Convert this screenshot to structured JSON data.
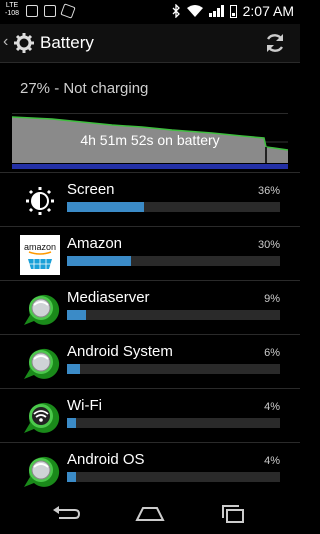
{
  "status_bar": {
    "network_label_top": "LTE",
    "network_label_bottom": "-108",
    "time": "2:07 AM"
  },
  "action_bar": {
    "title": "Battery",
    "icon": "battery-settings-icon",
    "refresh_icon": "refresh-icon"
  },
  "battery": {
    "status": "27% - Not charging",
    "graph_label": "4h 51m 52s on battery",
    "level_fraction": 0.27
  },
  "usage": [
    {
      "name": "Screen",
      "percent": "36%",
      "value": 36,
      "icon": "screen-brightness-icon"
    },
    {
      "name": "Amazon",
      "percent": "30%",
      "value": 30,
      "icon": "amazon-icon",
      "icon_text": "amazon"
    },
    {
      "name": "Mediaserver",
      "percent": "9%",
      "value": 9,
      "icon": "android-system-icon"
    },
    {
      "name": "Android System",
      "percent": "6%",
      "value": 6,
      "icon": "android-system-icon"
    },
    {
      "name": "Wi-Fi",
      "percent": "4%",
      "value": 4,
      "icon": "wifi-icon"
    },
    {
      "name": "Android OS",
      "percent": "4%",
      "value": 4,
      "icon": "android-system-icon"
    }
  ],
  "nav_bar": {
    "back_icon": "back-icon",
    "home_icon": "home-icon",
    "recents_icon": "recents-icon"
  },
  "colors": {
    "bar_fill": "#3b8bc7",
    "bar_track": "#2a2a2a",
    "graph_line": "#3fbf3f",
    "graph_fill": "#8a8a8a"
  }
}
